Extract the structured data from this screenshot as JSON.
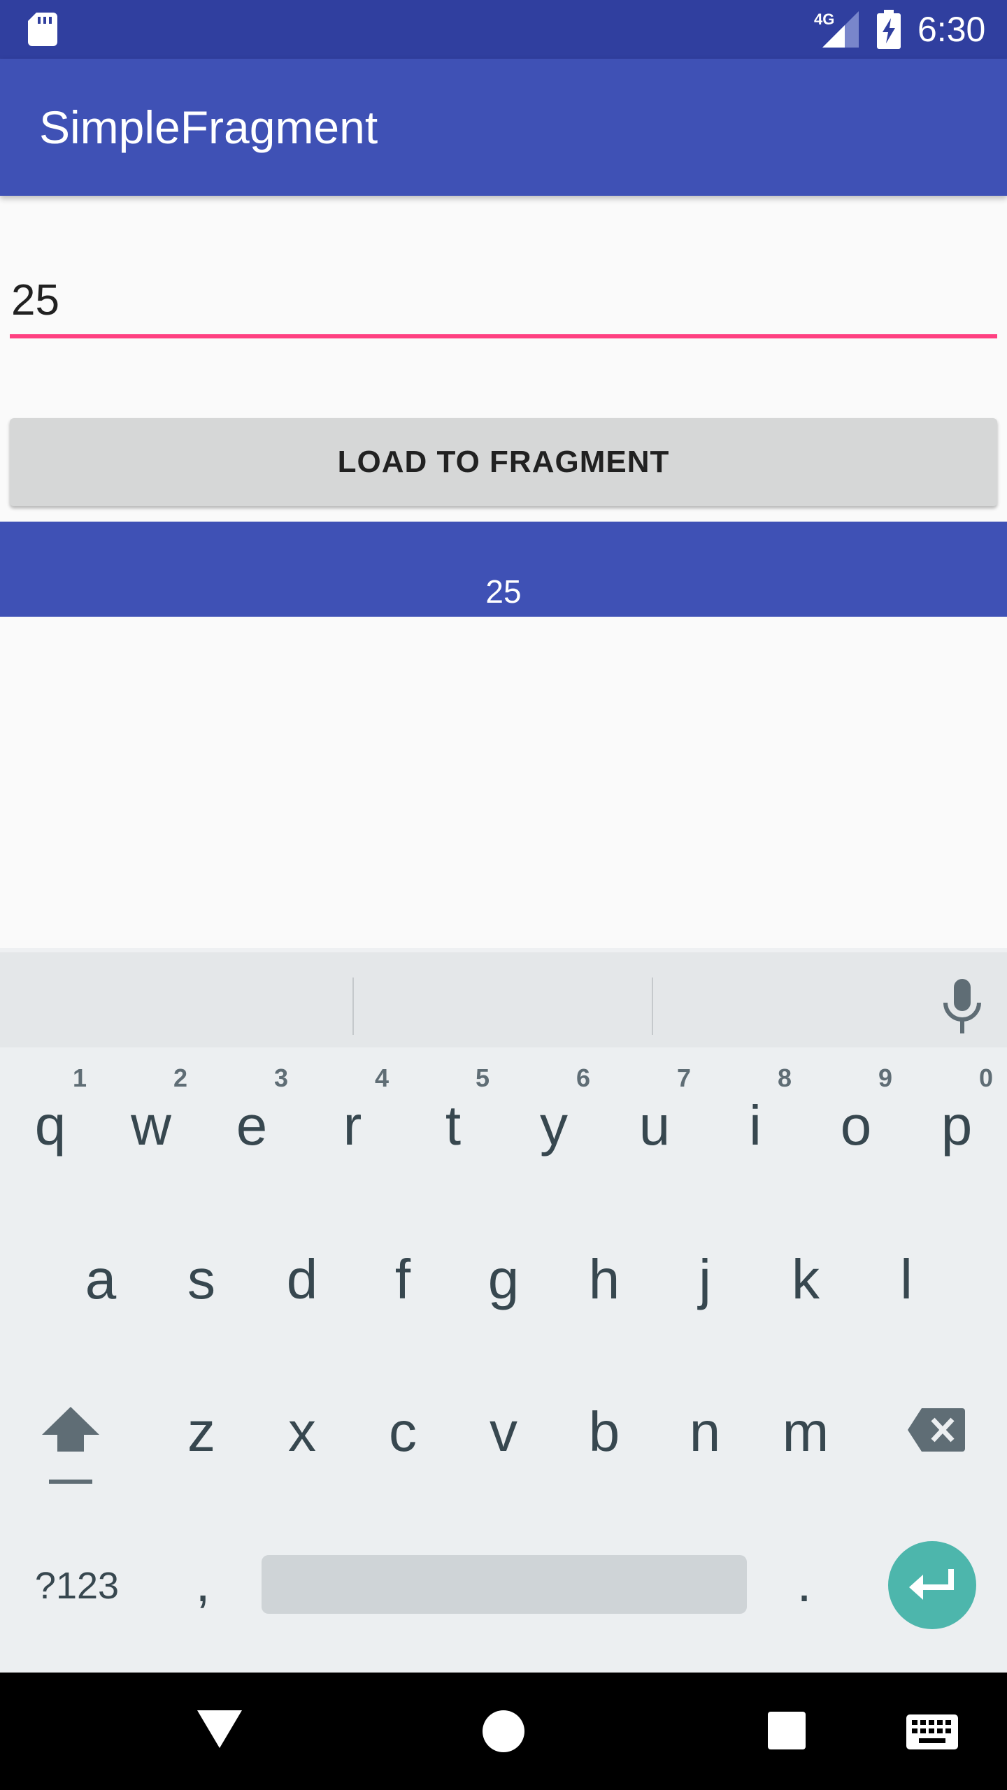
{
  "status_bar": {
    "network_label": "4G",
    "time": "6:30",
    "icons": [
      "sd-card-icon",
      "cellular-signal-icon",
      "battery-charging-icon"
    ]
  },
  "app_bar": {
    "title": "SimpleFragment"
  },
  "form": {
    "input_value": "25",
    "load_button_label": "LOAD TO FRAGMENT"
  },
  "fragment": {
    "value": "25"
  },
  "keyboard": {
    "row1": [
      {
        "key": "q",
        "hint": "1"
      },
      {
        "key": "w",
        "hint": "2"
      },
      {
        "key": "e",
        "hint": "3"
      },
      {
        "key": "r",
        "hint": "4"
      },
      {
        "key": "t",
        "hint": "5"
      },
      {
        "key": "y",
        "hint": "6"
      },
      {
        "key": "u",
        "hint": "7"
      },
      {
        "key": "i",
        "hint": "8"
      },
      {
        "key": "o",
        "hint": "9"
      },
      {
        "key": "p",
        "hint": "0"
      }
    ],
    "row2": [
      "a",
      "s",
      "d",
      "f",
      "g",
      "h",
      "j",
      "k",
      "l"
    ],
    "row3": [
      "z",
      "x",
      "c",
      "v",
      "b",
      "n",
      "m"
    ],
    "symbols_label": "?123",
    "comma": ",",
    "period": ".",
    "icons": [
      "mic-icon",
      "shift-icon",
      "backspace-icon",
      "enter-icon"
    ]
  },
  "colors": {
    "status_bar": "#303f9f",
    "app_bar": "#3f51b5",
    "accent": "#ff4081",
    "enter_key": "#4db6ac"
  },
  "nav_bar": {
    "icons": [
      "back-icon",
      "home-icon",
      "recents-icon",
      "keyboard-switch-icon"
    ]
  }
}
